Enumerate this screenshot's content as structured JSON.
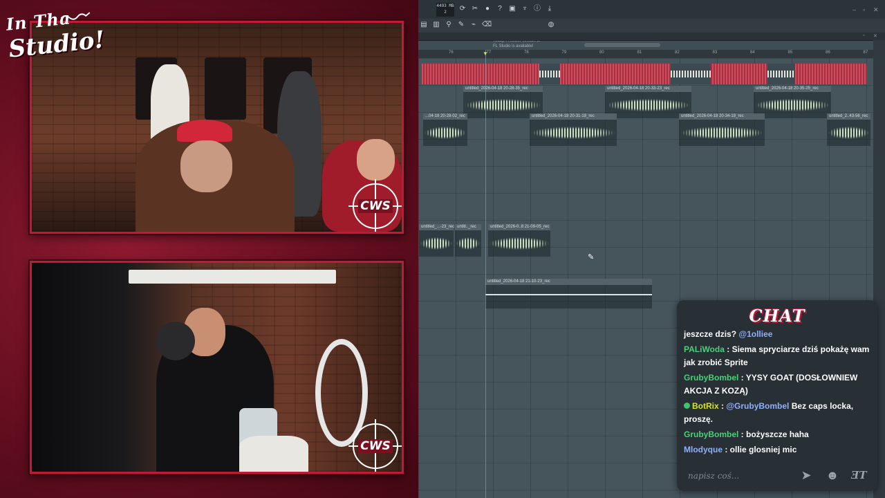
{
  "overlay": {
    "logo_line1": "In Tha",
    "logo_line2": "Studio!",
    "cam_logo": "CWS"
  },
  "daw": {
    "memory_readout": "4493 MB",
    "memory_value": "2",
    "news_line1": "Today: A newer version of",
    "news_line2": "FL Studio is available!",
    "ruler_ticks": [
      "76",
      "77",
      "78",
      "79",
      "80",
      "81",
      "82",
      "83",
      "84",
      "85",
      "86",
      "87"
    ],
    "clips": [
      {
        "name": "untitled_2026-04-18 20-28-35_rec"
      },
      {
        "name": "untitled_2026-04-18 20-33-23_rec"
      },
      {
        "name": "untitled_2026-04-18 20-35-25_rec"
      },
      {
        "name": "...04-18 20-28-02_rec"
      },
      {
        "name": "untitled_2026-04-18 20-31-18_rec"
      },
      {
        "name": "untitled_2026-04-18 20-34-18_rec"
      },
      {
        "name": "untitled_2..43-56_rec"
      },
      {
        "name": "untitled_...-23_rec"
      },
      {
        "name": "untitl.._rec"
      },
      {
        "name": "untitled_2026-0..8 21-09-05_rec"
      },
      {
        "name": "untitled_2026-04-18 21-10-23_rec"
      }
    ]
  },
  "chat": {
    "title": "CHAT",
    "messages": [
      {
        "user": "",
        "user_color": "#ffffff",
        "text": "jeszcze dzis? ",
        "mention": "@1olliee"
      },
      {
        "user": "PALiWoda",
        "user_color": "#49d17a",
        "text": "Siema spryciarze dziś pokażę wam jak zrobić Sprite",
        "mention": ""
      },
      {
        "user": "GrubyBombel",
        "user_color": "#49d17a",
        "text": "YYSY GOAT (DOSŁOWNIEW AKCJA Z KOZĄ)",
        "mention": ""
      },
      {
        "user": "BotRix",
        "user_color": "#d7e61a",
        "text": "Bez caps locka, proszę.",
        "mention": "@GrubyBombel",
        "badge": true
      },
      {
        "user": "GrubyBombel",
        "user_color": "#49d17a",
        "text": "bożyszcze haha",
        "mention": ""
      },
      {
        "user": "Mlodyque",
        "user_color": "#8fb0ff",
        "text": "ollie glosniej mic",
        "mention": ""
      }
    ],
    "input_placeholder": "napisz coś...",
    "mention_color": "#8fb0ff",
    "icons": [
      "send-icon",
      "emoji-icon",
      "emote-icon"
    ],
    "emote_glyph": "ƎT"
  }
}
